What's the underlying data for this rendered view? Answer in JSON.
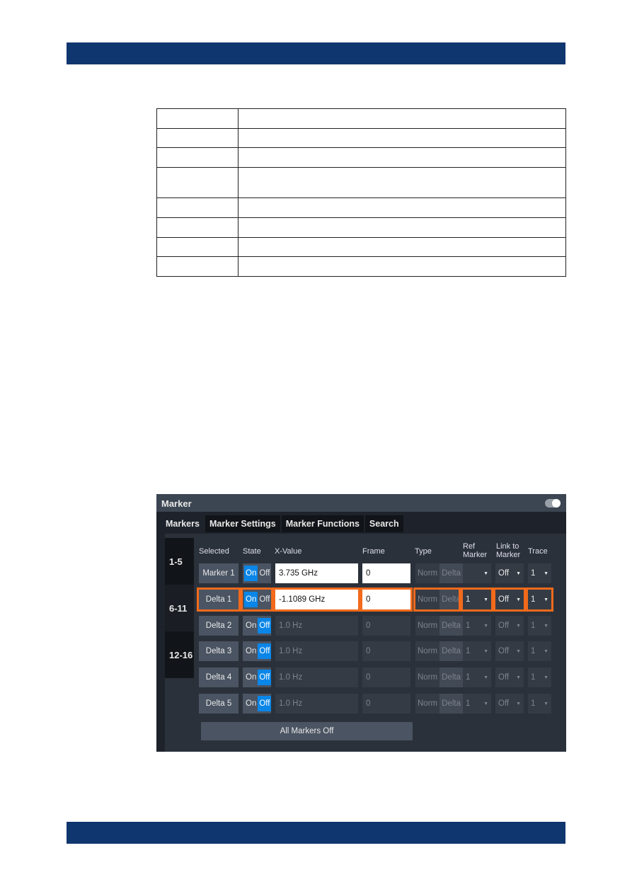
{
  "dialog": {
    "title": "Marker",
    "tabs": [
      "Markers",
      "Marker Settings",
      "Marker Functions",
      "Search"
    ],
    "side_tabs": [
      "1-5",
      "6-11",
      "12-16"
    ],
    "headers": {
      "selected": "Selected",
      "state": "State",
      "xvalue": "X-Value",
      "frame": "Frame",
      "type": "Type",
      "ref": "Ref Marker",
      "link": "Link to Marker",
      "trace": "Trace"
    },
    "state_on": "On",
    "state_off": "Off",
    "type_norm": "Norm",
    "type_delta": "Delta",
    "rows": [
      {
        "name": "Marker 1",
        "state": "On",
        "x": "3.735 GHz",
        "frame": "0",
        "ref": "",
        "link": "Off",
        "trace": "1"
      },
      {
        "name": "Delta 1",
        "state": "On",
        "x": "-1.1089 GHz",
        "frame": "0",
        "ref": "1",
        "link": "Off",
        "trace": "1"
      },
      {
        "name": "Delta 2",
        "state": "Off",
        "x": "1.0 Hz",
        "frame": "0",
        "ref": "1",
        "link": "Off",
        "trace": "1"
      },
      {
        "name": "Delta 3",
        "state": "Off",
        "x": "1.0 Hz",
        "frame": "0",
        "ref": "1",
        "link": "Off",
        "trace": "1"
      },
      {
        "name": "Delta 4",
        "state": "Off",
        "x": "1.0 Hz",
        "frame": "0",
        "ref": "1",
        "link": "Off",
        "trace": "1"
      },
      {
        "name": "Delta 5",
        "state": "Off",
        "x": "1.0 Hz",
        "frame": "0",
        "ref": "1",
        "link": "Off",
        "trace": "1"
      }
    ],
    "all_off": "All Markers Off",
    "colors": {
      "accent": "#0a86e8",
      "highlight": "#f26a1b",
      "brand": "#10366f"
    }
  }
}
